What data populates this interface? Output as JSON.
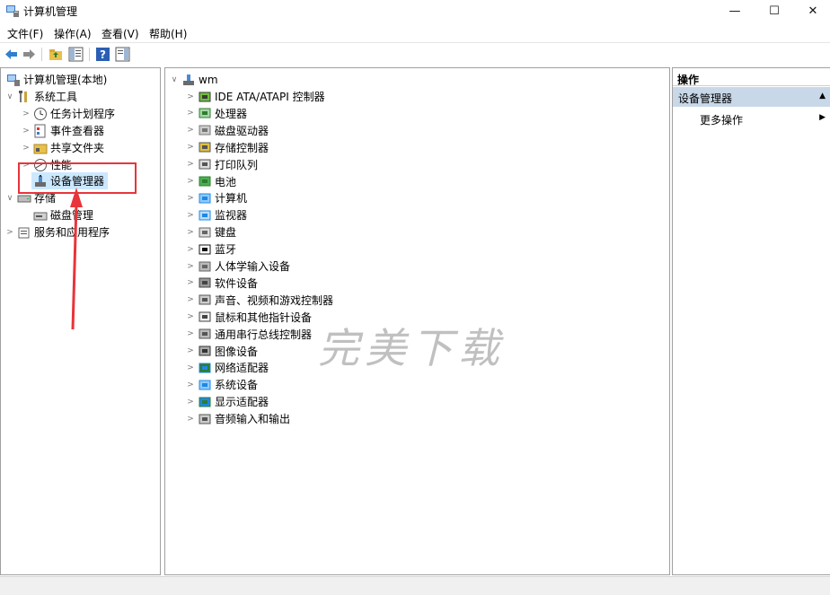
{
  "window": {
    "title": "计算机管理",
    "minimize": "—",
    "maximize": "☐",
    "close": "✕"
  },
  "menu": [
    "文件(F)",
    "操作(A)",
    "查看(V)",
    "帮助(H)"
  ],
  "left_tree": {
    "root": "计算机管理(本地)",
    "system_tools": "系统工具",
    "task_scheduler": "任务计划程序",
    "event_viewer": "事件查看器",
    "shared_folders": "共享文件夹",
    "performance": "性能",
    "device_manager": "设备管理器",
    "storage": "存储",
    "disk_management": "磁盘管理",
    "services_apps": "服务和应用程序"
  },
  "devices": {
    "root": "wm",
    "items": [
      {
        "label": "IDE ATA/ATAPI 控制器",
        "icon": "ide-controller-icon"
      },
      {
        "label": "处理器",
        "icon": "processor-icon"
      },
      {
        "label": "磁盘驱动器",
        "icon": "disk-drive-icon"
      },
      {
        "label": "存储控制器",
        "icon": "storage-controller-icon"
      },
      {
        "label": "打印队列",
        "icon": "printer-icon"
      },
      {
        "label": "电池",
        "icon": "battery-icon"
      },
      {
        "label": "计算机",
        "icon": "computer-icon"
      },
      {
        "label": "监视器",
        "icon": "monitor-icon"
      },
      {
        "label": "键盘",
        "icon": "keyboard-icon"
      },
      {
        "label": "蓝牙",
        "icon": "bluetooth-icon"
      },
      {
        "label": "人体学输入设备",
        "icon": "hid-icon"
      },
      {
        "label": "软件设备",
        "icon": "software-device-icon"
      },
      {
        "label": "声音、视频和游戏控制器",
        "icon": "sound-icon"
      },
      {
        "label": "鼠标和其他指针设备",
        "icon": "mouse-icon"
      },
      {
        "label": "通用串行总线控制器",
        "icon": "usb-icon"
      },
      {
        "label": "图像设备",
        "icon": "camera-icon"
      },
      {
        "label": "网络适配器",
        "icon": "network-adapter-icon"
      },
      {
        "label": "系统设备",
        "icon": "system-device-icon"
      },
      {
        "label": "显示适配器",
        "icon": "display-adapter-icon"
      },
      {
        "label": "音频输入和输出",
        "icon": "audio-io-icon"
      }
    ]
  },
  "actions": {
    "header": "操作",
    "section": "设备管理器",
    "more": "更多操作"
  },
  "watermark": "完美下载",
  "colors": {
    "highlight_box": "#e8343a",
    "arrow": "#e8343a",
    "selection": "#cce8ff",
    "action_section_bg": "#c8d8e8"
  }
}
